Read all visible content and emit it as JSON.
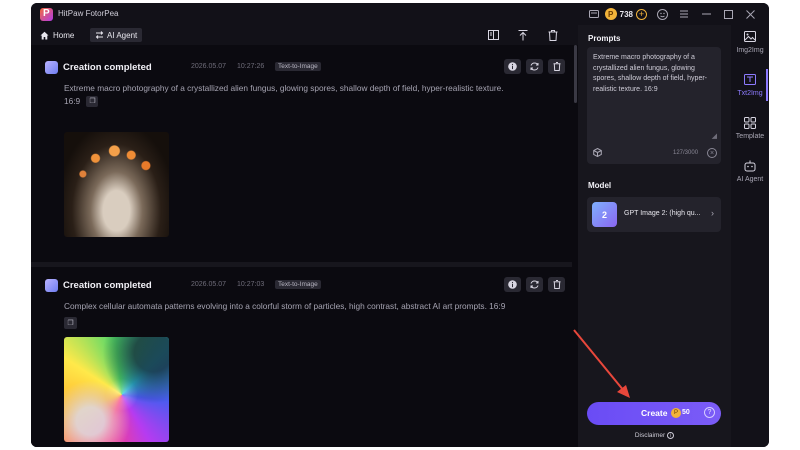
{
  "app": {
    "title": "HitPaw FotorPea",
    "logo_letter": "P",
    "credits": "738"
  },
  "titlebar": {
    "icons": [
      "screen-icon",
      "coin-icon",
      "add-credits-icon",
      "account-icon",
      "menu-icon",
      "minimize-icon",
      "maximize-icon",
      "close-icon"
    ]
  },
  "nav": {
    "home": "Home",
    "ai_agent": "AI Agent"
  },
  "feed": {
    "cards": [
      {
        "title": "Creation completed",
        "date": "2026.05.07",
        "time": "10:27:26",
        "tag": "Text-to-Image",
        "prompt": "Extreme macro photography of a crystallized alien fungus, glowing spores, shallow depth of field, hyper-realistic texture.",
        "ratio": "16:9"
      },
      {
        "title": "Creation completed",
        "date": "2026.05.07",
        "time": "10:27:03",
        "tag": "Text-to-Image",
        "prompt": "Complex cellular automata patterns evolving into a colorful storm of particles, high contrast, abstract AI art prompts. 16:9"
      }
    ]
  },
  "panel": {
    "prompts_label": "Prompts",
    "prompt_text": "Extreme macro photography of a crystallized alien fungus, glowing spores, shallow depth of field, hyper-realistic texture. 16:9",
    "char_count": "127/3000",
    "model_label": "Model",
    "model_name": "GPT Image 2: (high qu...",
    "model_icon_text": "2",
    "create_label": "Create",
    "create_cost": "50",
    "disclaimer": "Disclaimer"
  },
  "rail": {
    "items": [
      {
        "label": "Img2Img",
        "icon": "image-icon"
      },
      {
        "label": "Txt2Img",
        "icon": "text-image-icon",
        "active": true
      },
      {
        "label": "Template",
        "icon": "grid-icon"
      },
      {
        "label": "AI Agent",
        "icon": "robot-icon"
      }
    ]
  },
  "colors": {
    "accent": "#7b5cf7",
    "background": "#121118",
    "panel": "#17161d",
    "annotation_arrow": "#e8473b"
  }
}
